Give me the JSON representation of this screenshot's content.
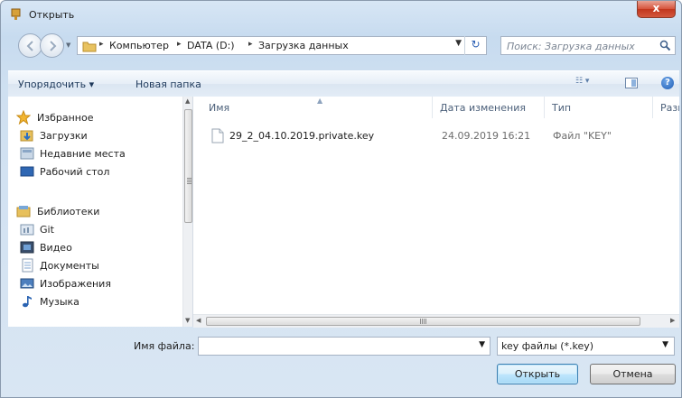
{
  "window": {
    "title": "Открыть",
    "close_glyph": "x"
  },
  "address": {
    "crumbs": [
      "Компьютер",
      "DATA (D:)",
      "Загрузка данных"
    ],
    "separator": "▸"
  },
  "search": {
    "placeholder": "Поиск: Загрузка данных"
  },
  "toolbar": {
    "organize_label": "Упорядочить ▾",
    "new_folder_label": "Новая папка",
    "view_label": "☷ ▾",
    "help_label": "?"
  },
  "sidebar": {
    "favorites": {
      "label": "Избранное",
      "items": [
        {
          "label": "Загрузки",
          "icon": "downloads-folder-icon"
        },
        {
          "label": "Недавние места",
          "icon": "recent-places-icon"
        },
        {
          "label": "Рабочий стол",
          "icon": "desktop-icon"
        }
      ]
    },
    "libraries": {
      "label": "Библиотеки",
      "items": [
        {
          "label": "Git",
          "icon": "git-library-icon"
        },
        {
          "label": "Видео",
          "icon": "video-library-icon"
        },
        {
          "label": "Документы",
          "icon": "documents-library-icon"
        },
        {
          "label": "Изображения",
          "icon": "pictures-library-icon"
        },
        {
          "label": "Музыка",
          "icon": "music-library-icon"
        }
      ]
    }
  },
  "filelist": {
    "columns": [
      "Имя",
      "Дата изменения",
      "Тип",
      "Размер"
    ],
    "files": [
      {
        "name": "29_2_04.10.2019.private.key",
        "modified": "24.09.2019 16:21",
        "type": "Файл \"KEY\""
      }
    ]
  },
  "bottom": {
    "filename_label": "Имя файла:",
    "filename_value": "",
    "filter_value": "key файлы (*.key)",
    "open_label": "Открыть",
    "cancel_label": "Отмена"
  },
  "colors": {
    "window_frame": "#d7e6f5",
    "close_button": "#c2361d",
    "link_text": "#1e395b"
  }
}
